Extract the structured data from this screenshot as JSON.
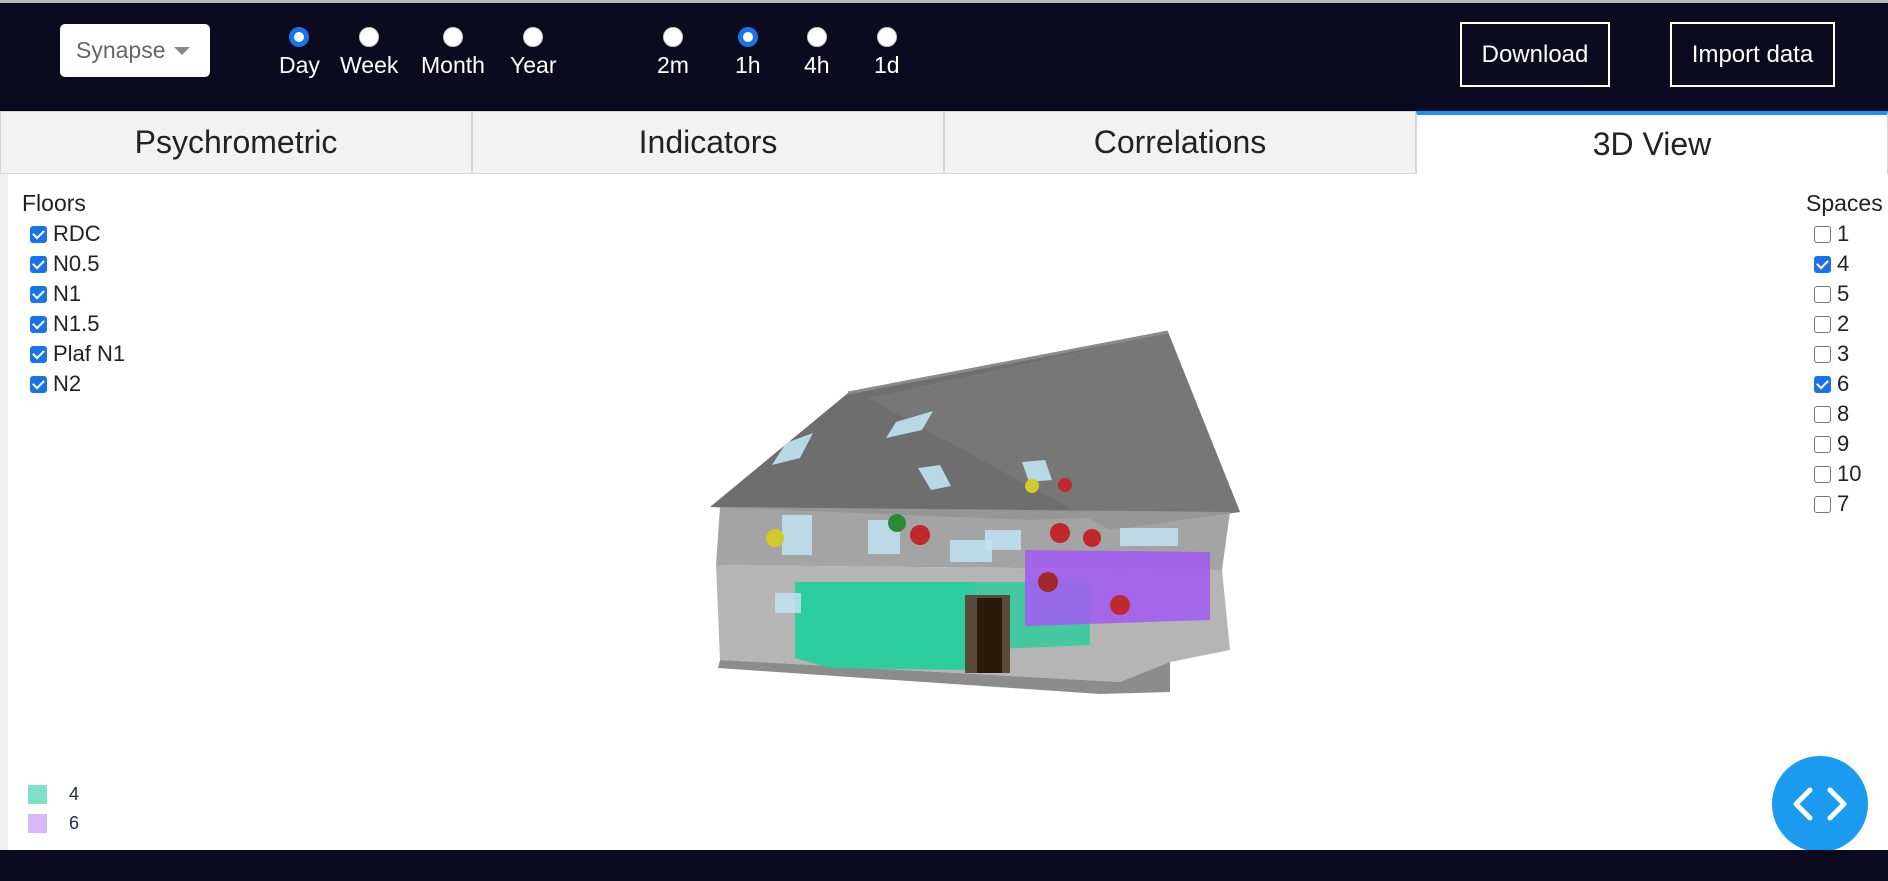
{
  "header": {
    "building_select": "Synapse",
    "period_options": [
      {
        "label": "Day",
        "checked": true
      },
      {
        "label": "Week",
        "checked": false
      },
      {
        "label": "Month",
        "checked": false
      },
      {
        "label": "Year",
        "checked": false
      }
    ],
    "interval_options": [
      {
        "label": "2m",
        "checked": false
      },
      {
        "label": "1h",
        "checked": true
      },
      {
        "label": "4h",
        "checked": false
      },
      {
        "label": "1d",
        "checked": false
      }
    ],
    "download_label": "Download",
    "import_label": "Import data"
  },
  "tabs": [
    {
      "label": "Psychrometric",
      "active": false
    },
    {
      "label": "Indicators",
      "active": false
    },
    {
      "label": "Correlations",
      "active": false
    },
    {
      "label": "3D View",
      "active": true
    }
  ],
  "floors": {
    "title": "Floors",
    "items": [
      {
        "label": "RDC",
        "checked": true
      },
      {
        "label": "N0.5",
        "checked": true
      },
      {
        "label": "N1",
        "checked": true
      },
      {
        "label": "N1.5",
        "checked": true
      },
      {
        "label": "Plaf N1",
        "checked": true
      },
      {
        "label": "N2",
        "checked": true
      }
    ]
  },
  "spaces": {
    "title": "Spaces",
    "items": [
      {
        "label": "1",
        "checked": false
      },
      {
        "label": "4",
        "checked": true
      },
      {
        "label": "5",
        "checked": false
      },
      {
        "label": "2",
        "checked": false
      },
      {
        "label": "3",
        "checked": false
      },
      {
        "label": "6",
        "checked": true
      },
      {
        "label": "8",
        "checked": false
      },
      {
        "label": "9",
        "checked": false
      },
      {
        "label": "10",
        "checked": false
      },
      {
        "label": "7",
        "checked": false
      }
    ]
  },
  "legend": [
    {
      "label": "4",
      "color": "#7fe0c8"
    },
    {
      "label": "6",
      "color": "#d8b8f8"
    }
  ],
  "colors": {
    "header_bg": "#0b0b1f",
    "accent": "#1a8fff",
    "space_4": "#1fcf9a",
    "space_6": "#a35cf0"
  },
  "icons": {
    "code_button": "code-brackets-icon",
    "select_caret": "caret-down-icon"
  }
}
